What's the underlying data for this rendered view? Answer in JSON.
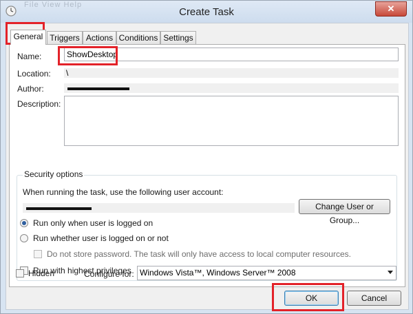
{
  "window": {
    "title": "Create Task",
    "faded_menu": "File   View   Help",
    "close_glyph": "✕"
  },
  "tabs": [
    {
      "label": "General",
      "active": true
    },
    {
      "label": "Triggers"
    },
    {
      "label": "Actions"
    },
    {
      "label": "Conditions"
    },
    {
      "label": "Settings"
    }
  ],
  "general": {
    "name_label": "Name:",
    "name_value": "ShowDesktop",
    "location_label": "Location:",
    "location_value": "\\",
    "author_label": "Author:",
    "description_label": "Description:",
    "description_value": ""
  },
  "security": {
    "title": "Security options",
    "run_as_text": "When running the task, use the following user account:",
    "change_user_button": "Change User or Group...",
    "radio_logged_on": "Run only when user is logged on",
    "radio_logged_on_selected": true,
    "radio_whether": "Run whether user is logged on or not",
    "no_store_password": "Do not store password.  The task will only have access to local computer resources.",
    "highest_priv": "Run with highest privileges"
  },
  "bottom": {
    "hidden_label": "Hidden",
    "configure_label": "Configure for:",
    "configure_value": "Windows Vista™, Windows Server™ 2008"
  },
  "buttons": {
    "ok": "OK",
    "cancel": "Cancel"
  },
  "colors": {
    "highlight": "#e32229",
    "radio_dot": "#2f5f9f"
  },
  "icons": {
    "title": "clock-icon",
    "close": "close-icon",
    "dropdown": "chevron-down-icon"
  }
}
